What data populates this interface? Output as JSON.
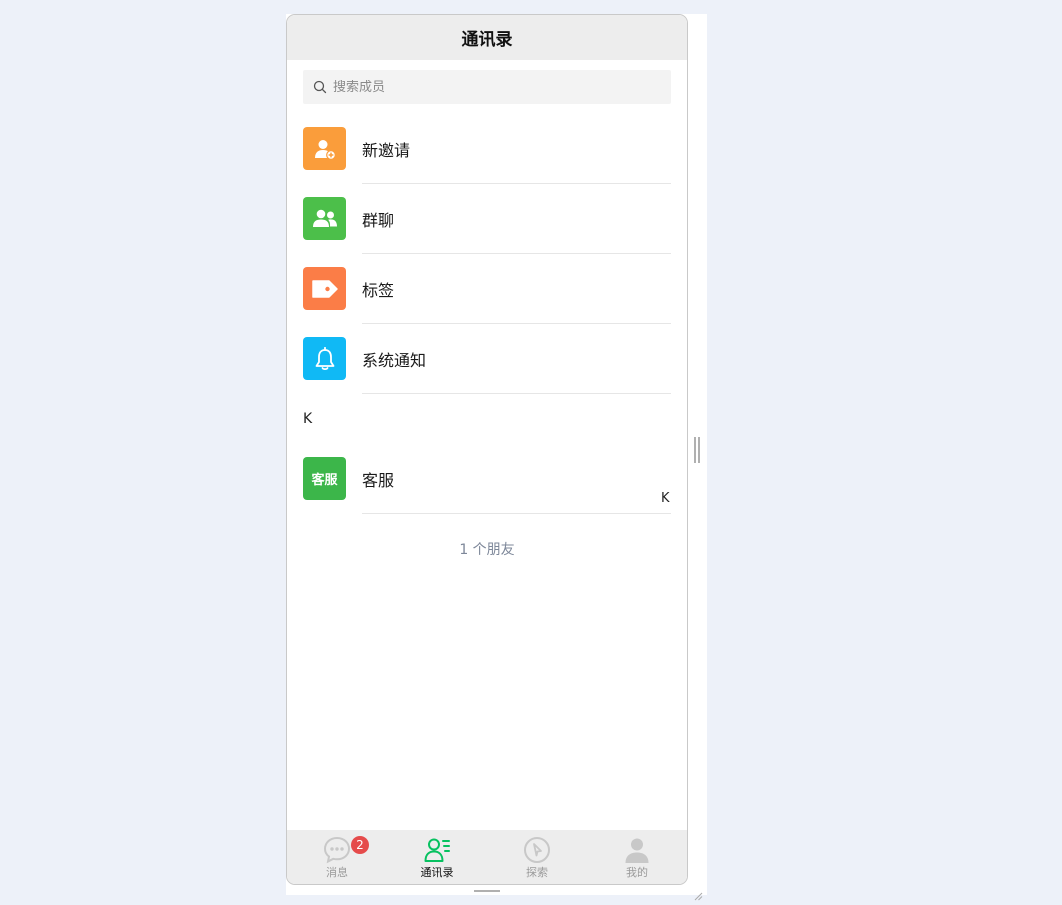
{
  "nav": {
    "title": "通讯录"
  },
  "search": {
    "placeholder": "搜索成员"
  },
  "menu": [
    {
      "label": "新邀请",
      "icon": "add-friend-icon",
      "color": "#fa9d3b"
    },
    {
      "label": "群聊",
      "icon": "group-chat-icon",
      "color": "#4cbf4a"
    },
    {
      "label": "标签",
      "icon": "tag-icon",
      "color": "#fb7d47"
    },
    {
      "label": "系统通知",
      "icon": "bell-icon",
      "color": "#10b9f5"
    }
  ],
  "section": {
    "letter": "K"
  },
  "contacts": [
    {
      "label": "客服",
      "avatar_text": "客服",
      "color": "#3cb64a"
    }
  ],
  "index": {
    "letter": "K"
  },
  "friend_count": "1 个朋友",
  "tabs": [
    {
      "label": "消息",
      "icon": "chat-icon",
      "badge": "2"
    },
    {
      "label": "通讯录",
      "icon": "contacts-icon"
    },
    {
      "label": "探索",
      "icon": "compass-icon"
    },
    {
      "label": "我的",
      "icon": "user-icon"
    }
  ],
  "colors": {
    "accent": "#07c160",
    "badge": "#e54b4b",
    "nav_bg": "#ededed"
  }
}
